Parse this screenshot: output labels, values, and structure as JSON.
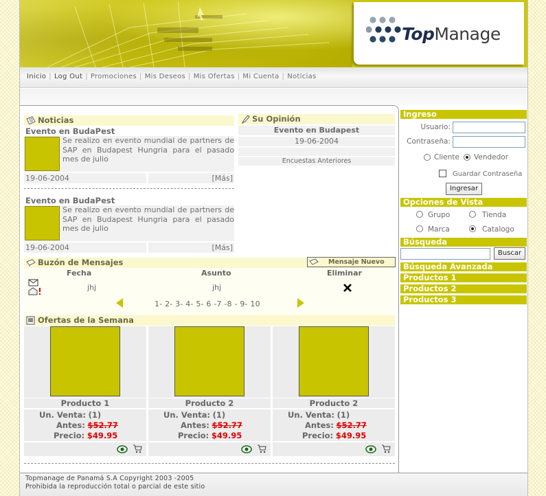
{
  "brand": {
    "logo_bold": "Top",
    "logo_rest": "Manage"
  },
  "nav": [
    "Inicio",
    "Log Out",
    "Promociones",
    "Mis Deseos",
    "Mis Ofertas",
    "Mi Cuenta",
    "Noticias"
  ],
  "news": {
    "title": "Noticias",
    "items": [
      {
        "title": "Evento en BudaPest",
        "body": "Se realizo en evento mundial de partners de SAP en Budapest Hungria para el pasado mes de julio",
        "date": "19-06-2004",
        "more": "[Más]"
      },
      {
        "title": "Evento en BudaPest",
        "body": "Se realizo en evento mundial de partners de SAP en Budapest Hungria para el pasado mes de julio",
        "date": "19-06-2004",
        "more": "[Más]"
      }
    ]
  },
  "opinion": {
    "title": "Su Opinión",
    "event": "Evento en Budapest",
    "date": "19-06-2004",
    "link": "Encuestas Anteriores"
  },
  "messages": {
    "title": "Buzón de Mensajes",
    "new_button": "Mensaje Nuevo",
    "headers": [
      "Fecha",
      "Asunto",
      "Eliminar"
    ],
    "row": {
      "fecha": "jhj",
      "asunto": "jhj"
    },
    "pages": [
      "1-",
      "2-",
      "3-",
      "4-",
      "5-",
      "6",
      "-7",
      "-8",
      "-",
      "9-",
      "10"
    ]
  },
  "offers": {
    "title": "Ofertas de la Semana",
    "unit_label": "Un. Venta:",
    "before_label": "Antes:",
    "price_label": "Precio:",
    "products": [
      {
        "name": "Producto 1",
        "unit": "(1)",
        "before": "$52.77",
        "price": "$49.95"
      },
      {
        "name": "Producto 2",
        "unit": "(1)",
        "before": "$52.77",
        "price": "$49.95"
      },
      {
        "name": "Producto 2",
        "unit": "(1)",
        "before": "$52.77",
        "price": "$49.95"
      }
    ]
  },
  "sidebar": {
    "login_title": "Ingreso",
    "user_label": "Usuario:",
    "pass_label": "Contraseña:",
    "radio_client": "Cliente",
    "radio_vendor": "Vendedor",
    "remember": "Guardar Contraseña",
    "login_button": "Ingresar",
    "view_title": "Opciones de Vista",
    "view_options": [
      "Grupo",
      "Tienda",
      "Marca",
      "Catalogo"
    ],
    "search_title": "Búsqueda",
    "search_button": "Buscar",
    "links": [
      "Búsqueda Avanzada",
      "Productos 1",
      "Productos 2",
      "Productos 3"
    ]
  },
  "footer": {
    "line1": "Topmanage de Panamá S.A Copyright 2003 -2005",
    "line2": "Prohibida la reproducción total o parcial de este sitio"
  },
  "colors": {
    "accent": "#c8c500",
    "section_bg": "#fbf8cd",
    "price_red": "#e00000"
  }
}
